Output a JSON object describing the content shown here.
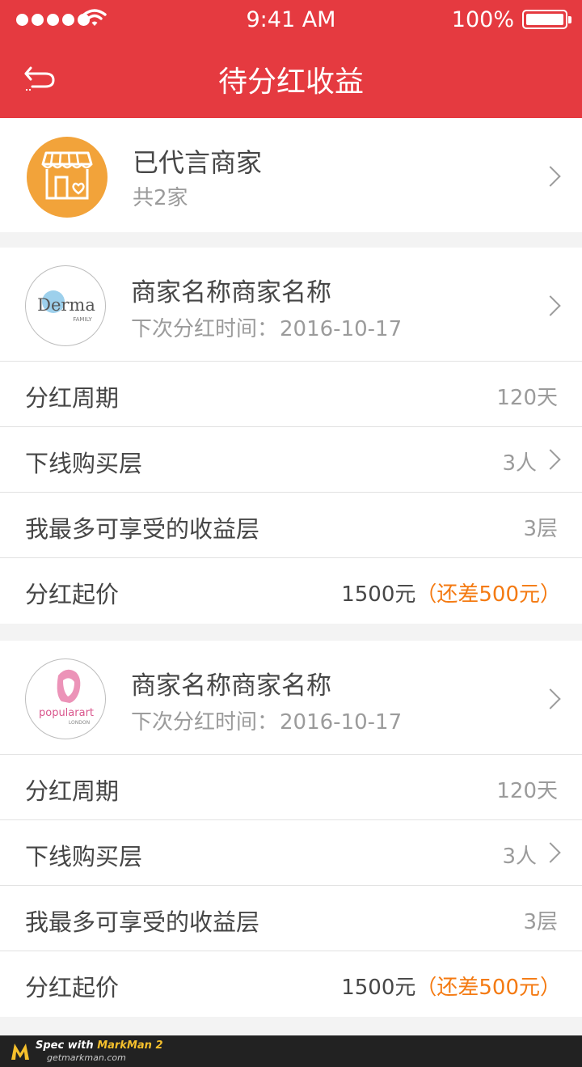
{
  "status_bar": {
    "time": "9:41 AM",
    "battery": "100%"
  },
  "nav": {
    "title": "待分红收益"
  },
  "agent_summary": {
    "title": "已代言商家",
    "subtitle": "共2家"
  },
  "merchants": [
    {
      "logo_name": "Derma",
      "logo_sub": "FAMILY",
      "name": "商家名称商家名称",
      "date_label": "下次分红时间：",
      "date_value": "2016-10-17",
      "rows": {
        "period": {
          "label": "分红周期",
          "value": "120天"
        },
        "downline": {
          "label": "下线购买层",
          "value": "3人"
        },
        "max_layer": {
          "label": "我最多可享受的收益层",
          "value": "3层"
        },
        "threshold": {
          "label": "分红起价",
          "value": "1500元",
          "note": "（还差500元）"
        }
      }
    },
    {
      "logo_name": "popularart",
      "logo_sub": "LONDON",
      "name": "商家名称商家名称",
      "date_label": "下次分红时间：",
      "date_value": "2016-10-17",
      "rows": {
        "period": {
          "label": "分红周期",
          "value": "120天"
        },
        "downline": {
          "label": "下线购买层",
          "value": "3人"
        },
        "max_layer": {
          "label": "我最多可享受的收益层",
          "value": "3层"
        },
        "threshold": {
          "label": "分红起价",
          "value": "1500元",
          "note": "（还差500元）"
        }
      }
    }
  ],
  "footer": {
    "brand_prefix": "Spec with ",
    "brand": "MarkMan 2",
    "url": "getmarkman.com"
  },
  "colors": {
    "primary": "#e53a40",
    "text": "#464646",
    "muted": "#9b9b9b",
    "accent": "#f47a12",
    "avatar": "#f2a33a"
  }
}
